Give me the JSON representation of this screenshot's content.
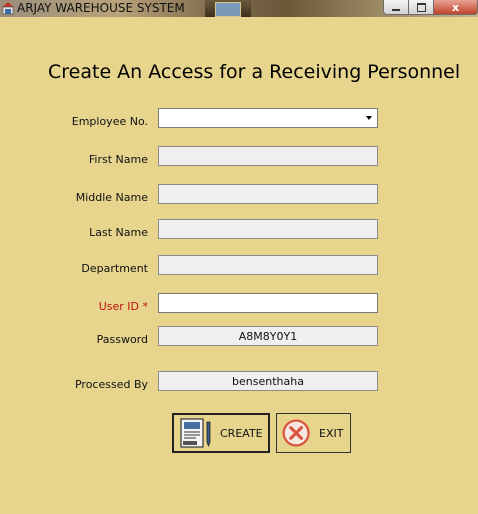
{
  "window": {
    "title": "ARJAY WAREHOUSE SYSTEM",
    "controls": {
      "close": "x"
    }
  },
  "heading": "Create An Access for a Receiving Personnel",
  "form": {
    "employee_no": {
      "label": "Employee No.",
      "value": ""
    },
    "first_name": {
      "label": "First Name",
      "value": ""
    },
    "middle_name": {
      "label": "Middle Name",
      "value": ""
    },
    "last_name": {
      "label": "Last Name",
      "value": ""
    },
    "department": {
      "label": "Department",
      "value": ""
    },
    "user_id": {
      "label": "User ID *",
      "value": ""
    },
    "password": {
      "label": "Password",
      "value": "A8M8Y0Y1"
    },
    "processed_by": {
      "label": "Processed By",
      "value": "bensenthaha"
    }
  },
  "buttons": {
    "create": "CREATE",
    "exit": "EXIT"
  },
  "colors": {
    "background": "#e7d58e",
    "required_label": "#c01010",
    "exit_icon": "#d9543c"
  },
  "icons": [
    "warehouse-app-icon",
    "form-document-icon",
    "exit-x-icon",
    "dropdown-arrow-icon"
  ]
}
